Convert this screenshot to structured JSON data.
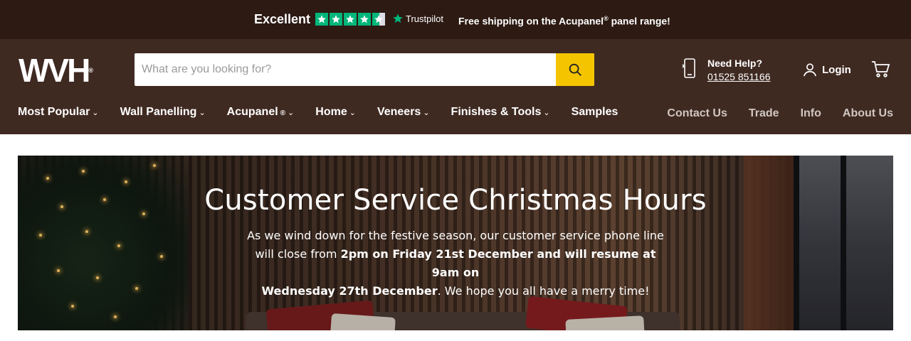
{
  "announcement": {
    "rating_word": "Excellent",
    "stars": 4.5,
    "trustpilot_label": "Trustpilot",
    "shipping_text_pre": "Free shipping on the Acupanel",
    "shipping_reg": "®",
    "shipping_text_post": " panel range!",
    "star_color": "#00b67a"
  },
  "header": {
    "logo_text": "WVH",
    "logo_reg": "®",
    "search": {
      "placeholder": "What are you looking for?",
      "value": "",
      "button_color": "#f5c400"
    },
    "help": {
      "title": "Need Help?",
      "phone": "01525 851166"
    },
    "login_label": "Login",
    "cart_icon": "cart-icon"
  },
  "nav": {
    "left": [
      {
        "label": "Most Popular",
        "dropdown": true
      },
      {
        "label": "Wall Panelling",
        "dropdown": true
      },
      {
        "label": "Acupanel",
        "reg": "®",
        "dropdown": true
      },
      {
        "label": "Home",
        "dropdown": true
      },
      {
        "label": "Veneers",
        "dropdown": true
      },
      {
        "label": "Finishes & Tools",
        "dropdown": true
      },
      {
        "label": "Samples",
        "dropdown": false
      }
    ],
    "right": [
      {
        "label": "Contact Us"
      },
      {
        "label": "Trade"
      },
      {
        "label": "Info"
      },
      {
        "label": "About Us"
      }
    ],
    "chevron": "⌄"
  },
  "banner": {
    "title": "Customer Service Christmas Hours",
    "line1": "As we wind down for the festive season, our customer service phone line",
    "line2_pre": "will close from ",
    "line2_bold": "2pm on Friday 21st December and will resume at 9am on",
    "line3_bold": "Wednesday 27th December",
    "line3_post": ". We hope you all have a merry time!"
  },
  "colors": {
    "topbar_bg": "#2c1a13",
    "header_bg": "#3f2a22",
    "accent": "#f5c400"
  }
}
